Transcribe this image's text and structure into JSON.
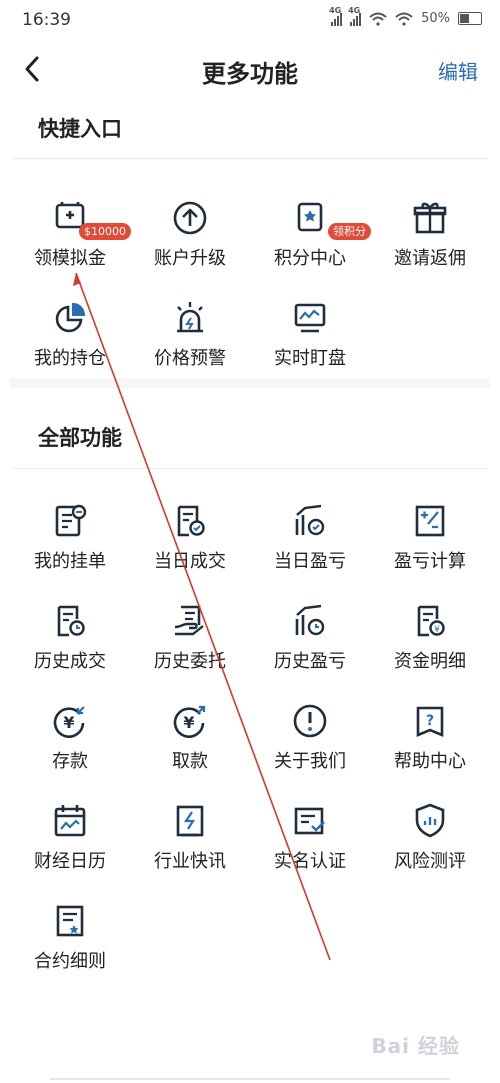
{
  "status": {
    "time": "16:39",
    "net1": "4G",
    "net2": "4G",
    "battery": "50%"
  },
  "header": {
    "title": "更多功能",
    "edit": "编辑"
  },
  "quick": {
    "title": "快捷入口",
    "items": [
      {
        "label": "领模拟金",
        "icon": "simulated-funds-icon",
        "badge": "$10000"
      },
      {
        "label": "账户升级",
        "icon": "arrow-up-circle-icon"
      },
      {
        "label": "积分中心",
        "icon": "points-icon",
        "badge": "领积分"
      },
      {
        "label": "邀请返佣",
        "icon": "gift-icon"
      },
      {
        "label": "我的持仓",
        "icon": "pie-chart-icon"
      },
      {
        "label": "价格预警",
        "icon": "alarm-icon"
      },
      {
        "label": "实时盯盘",
        "icon": "monitor-chart-icon"
      }
    ]
  },
  "all": {
    "title": "全部功能",
    "items": [
      {
        "label": "我的挂单",
        "icon": "pending-order-icon"
      },
      {
        "label": "当日成交",
        "icon": "today-deal-icon"
      },
      {
        "label": "当日盈亏",
        "icon": "today-pnl-icon"
      },
      {
        "label": "盈亏计算",
        "icon": "calculator-icon"
      },
      {
        "label": "历史成交",
        "icon": "history-deal-icon"
      },
      {
        "label": "历史委托",
        "icon": "history-order-icon"
      },
      {
        "label": "历史盈亏",
        "icon": "history-pnl-icon"
      },
      {
        "label": "资金明细",
        "icon": "funds-detail-icon"
      },
      {
        "label": "存款",
        "icon": "deposit-icon"
      },
      {
        "label": "取款",
        "icon": "withdraw-icon"
      },
      {
        "label": "关于我们",
        "icon": "info-icon"
      },
      {
        "label": "帮助中心",
        "icon": "help-icon"
      },
      {
        "label": "财经日历",
        "icon": "calendar-icon"
      },
      {
        "label": "行业快讯",
        "icon": "news-flash-icon"
      },
      {
        "label": "实名认证",
        "icon": "verification-icon"
      },
      {
        "label": "风险测评",
        "icon": "risk-shield-icon"
      },
      {
        "label": "合约细则",
        "icon": "contract-rules-icon"
      }
    ]
  },
  "watermark": "Bai 经验",
  "colors": {
    "dark": "#1f2d3d",
    "accent": "#2b6db3",
    "badge": "#e24b35"
  }
}
